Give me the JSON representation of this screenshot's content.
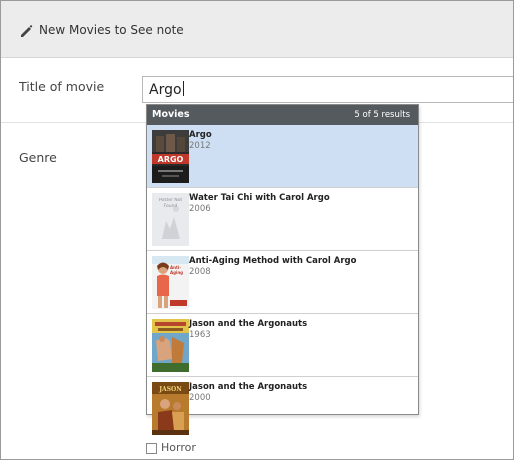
{
  "header": {
    "title": "New Movies to See note",
    "icon": "pencil-icon"
  },
  "form": {
    "title_label": "Title of movie",
    "title_value": "Argo",
    "genre_label": "Genre",
    "genre_options": [
      "Horror"
    ]
  },
  "dropdown": {
    "heading": "Movies",
    "count": "5 of 5 results",
    "selected_color": "#cfdff3",
    "results": [
      {
        "title": "Argo",
        "year": "2012",
        "poster_text": "ARGO"
      },
      {
        "title": "Water Tai Chi with Carol Argo",
        "year": "2006",
        "poster_text": "Poster Not Found"
      },
      {
        "title": "Anti-Aging Method with Carol Argo",
        "year": "2008",
        "poster_text": "Anti-Aging"
      },
      {
        "title": "Jason and the Argonauts",
        "year": "1963",
        "poster_text": ""
      },
      {
        "title": "Jason and the Argonauts",
        "year": "2000",
        "poster_text": "JASON"
      }
    ]
  }
}
